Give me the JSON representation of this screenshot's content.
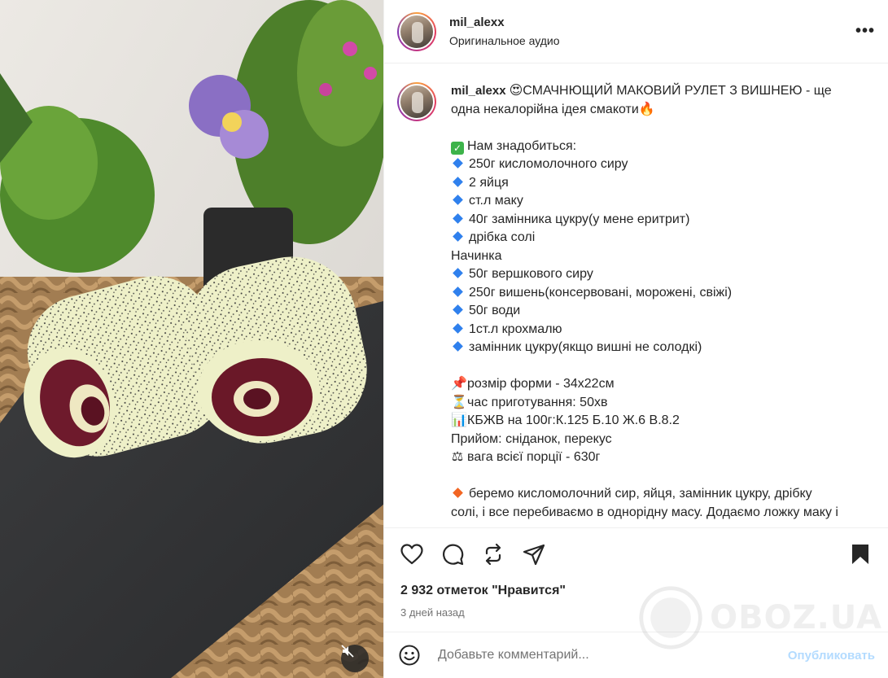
{
  "post": {
    "username": "mil_alexx",
    "audio": "Оригинальное аудио",
    "more_label": "•••"
  },
  "caption": {
    "username": "mil_alexx",
    "lines": {
      "l1": "СМАЧНЮЩИЙ МАКОВИЙ РУЛЕТ З ВИШНЕЮ - ще",
      "l2": "одна некалорійна ідея смакоти",
      "need": "Нам знадобиться:",
      "i1": "250г кисломолочного сиру",
      "i2": "2 яйця",
      "i3": "ст.л маку",
      "i4": "40г замінника цукру(у мене еритрит)",
      "i5": "дрібка солі",
      "filling": "Начинка",
      "f1": "50г вершкового сиру",
      "f2": "250г вишень(консервовані, морожені, свіжі)",
      "f3": "50г води",
      "f4": "1ст.л крохмалю",
      "f5": "замінник цукру(якщо вишні не солодкі)",
      "size": "розмір форми - 34х22см",
      "time": "час приготування: 50хв",
      "kbju": "КБЖВ на 100г:К.125 Б.10 Ж.6 В.8.2",
      "meal": "Прийом: сніданок, перекус",
      "weight": "вага всієї порції - 630г",
      "step1a": "беремо кисломолочний сир, яйця, замінник цукру, дрібку",
      "step1b": "солі, і все перебиваємо в однорідну масу. Додаємо ложку маку і"
    },
    "emoji": {
      "heart_eyes": "😍",
      "fire": "🔥",
      "check": "✓",
      "pin": "📌",
      "hourglass": "⏳",
      "chart": "📊",
      "scales": "⚖"
    }
  },
  "actions": {
    "likes": "2 932 отметок \"Нравится\"",
    "date": "3 дней назад"
  },
  "comment": {
    "placeholder": "Добавьте комментарий...",
    "publish": "Опубликовать"
  },
  "watermark": {
    "text": "OBOZ.UA"
  },
  "icons": [
    "heart-icon",
    "comment-icon",
    "repost-icon",
    "share-icon",
    "bookmark-icon",
    "emoji-icon",
    "muted-speaker-icon",
    "more-icon"
  ]
}
